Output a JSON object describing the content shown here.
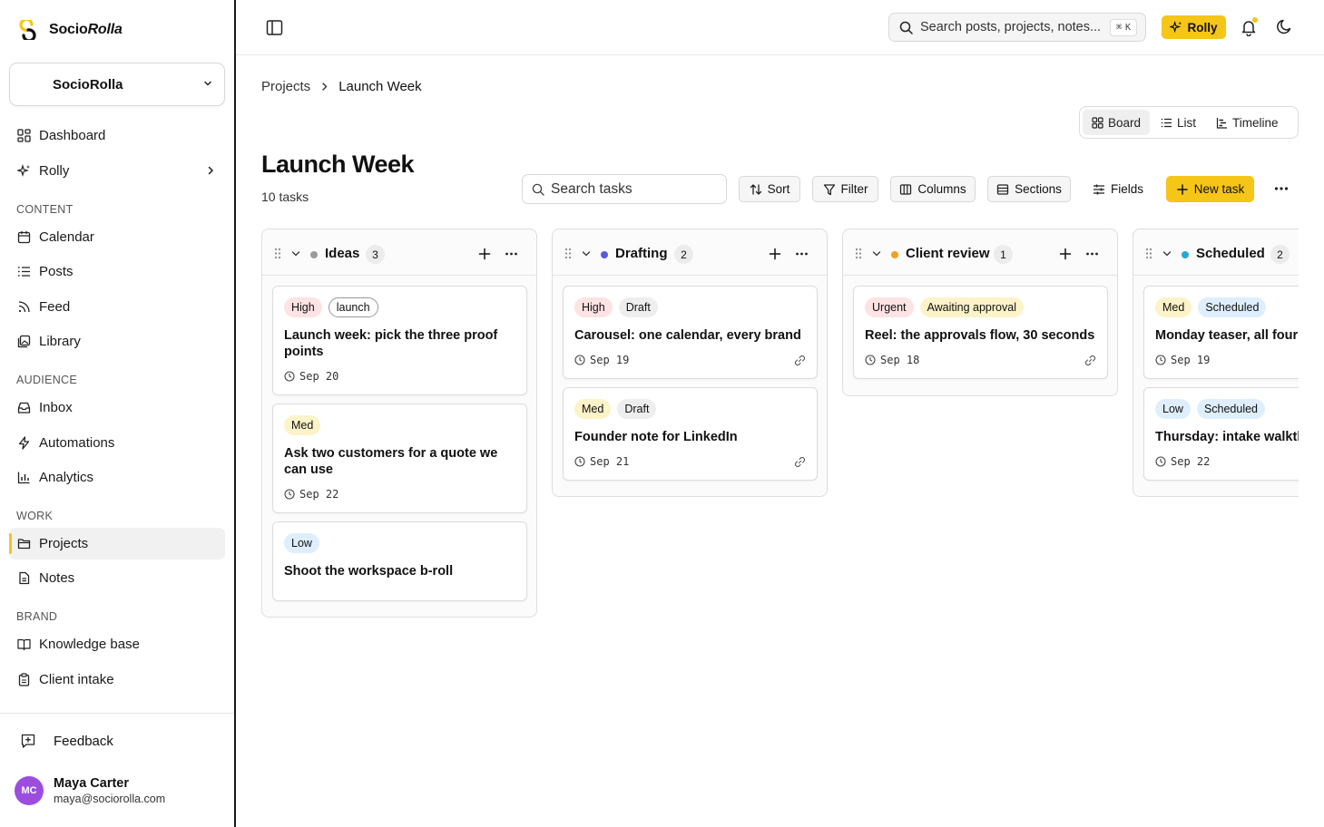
{
  "brand": {
    "name_main": "Socio",
    "name_italic": "Rolla"
  },
  "workspace": {
    "name": "SocioRolla"
  },
  "nav": {
    "dashboard": "Dashboard",
    "rolly": "Rolly",
    "section_content": "CONTENT",
    "calendar": "Calendar",
    "posts": "Posts",
    "feed": "Feed",
    "library": "Library",
    "section_audience": "AUDIENCE",
    "inbox": "Inbox",
    "automations": "Automations",
    "analytics": "Analytics",
    "section_work": "WORK",
    "projects": "Projects",
    "notes": "Notes",
    "section_brand": "BRAND",
    "knowledge_base": "Knowledge base",
    "client_intake": "Client intake"
  },
  "feedback": "Feedback",
  "user": {
    "initials": "MC",
    "name": "Maya Carter",
    "email": "maya@sociorolla.com"
  },
  "topbar": {
    "search_placeholder": "Search posts, projects, notes...",
    "shortcut_symbol": "⌘",
    "shortcut_key": "K",
    "rolly_label": "Rolly"
  },
  "breadcrumb": {
    "parent": "Projects",
    "current": "Launch Week"
  },
  "views": {
    "board": "Board",
    "list": "List",
    "timeline": "Timeline",
    "active": "Board"
  },
  "page": {
    "title": "Launch Week",
    "task_count": "10 tasks"
  },
  "toolbar": {
    "search_placeholder": "Search tasks",
    "sort": "Sort",
    "filter": "Filter",
    "columns": "Columns",
    "sections": "Sections",
    "fields": "Fields",
    "new_task": "New task"
  },
  "colors": {
    "accent": "#f5c518",
    "ideas": "#9a9a9a",
    "drafting": "#5b5bd6",
    "client_review": "#f0a020",
    "scheduled": "#2aa7d8"
  },
  "columns": [
    {
      "name": "Ideas",
      "count": "3",
      "cards": [
        {
          "tags": [
            "High",
            "launch"
          ],
          "title": "Launch week: pick the three proof points",
          "date": "Sep 20"
        },
        {
          "tags": [
            "Med"
          ],
          "title": "Ask two customers for a quote we can use",
          "date": "Sep 22"
        },
        {
          "tags": [
            "Low"
          ],
          "title": "Shoot the workspace b-roll"
        }
      ]
    },
    {
      "name": "Drafting",
      "count": "2",
      "cards": [
        {
          "tags": [
            "High",
            "Draft"
          ],
          "title": "Carousel: one calendar, every brand",
          "date": "Sep 19"
        },
        {
          "tags": [
            "Med",
            "Draft"
          ],
          "title": "Founder note for LinkedIn",
          "date": "Sep 21"
        }
      ]
    },
    {
      "name": "Client review",
      "count": "1",
      "cards": [
        {
          "tags": [
            "Urgent",
            "Awaiting approval"
          ],
          "title": "Reel: the approvals flow, 30 seconds",
          "date": "Sep 18"
        }
      ]
    },
    {
      "name": "Scheduled",
      "count": "2",
      "cards": [
        {
          "tags": [
            "Med",
            "Scheduled"
          ],
          "title": "Monday teaser, all four",
          "date": "Sep 19"
        },
        {
          "tags": [
            "Low",
            "Scheduled"
          ],
          "title": "Thursday: intake walkth",
          "date": "Sep 22"
        }
      ]
    }
  ]
}
